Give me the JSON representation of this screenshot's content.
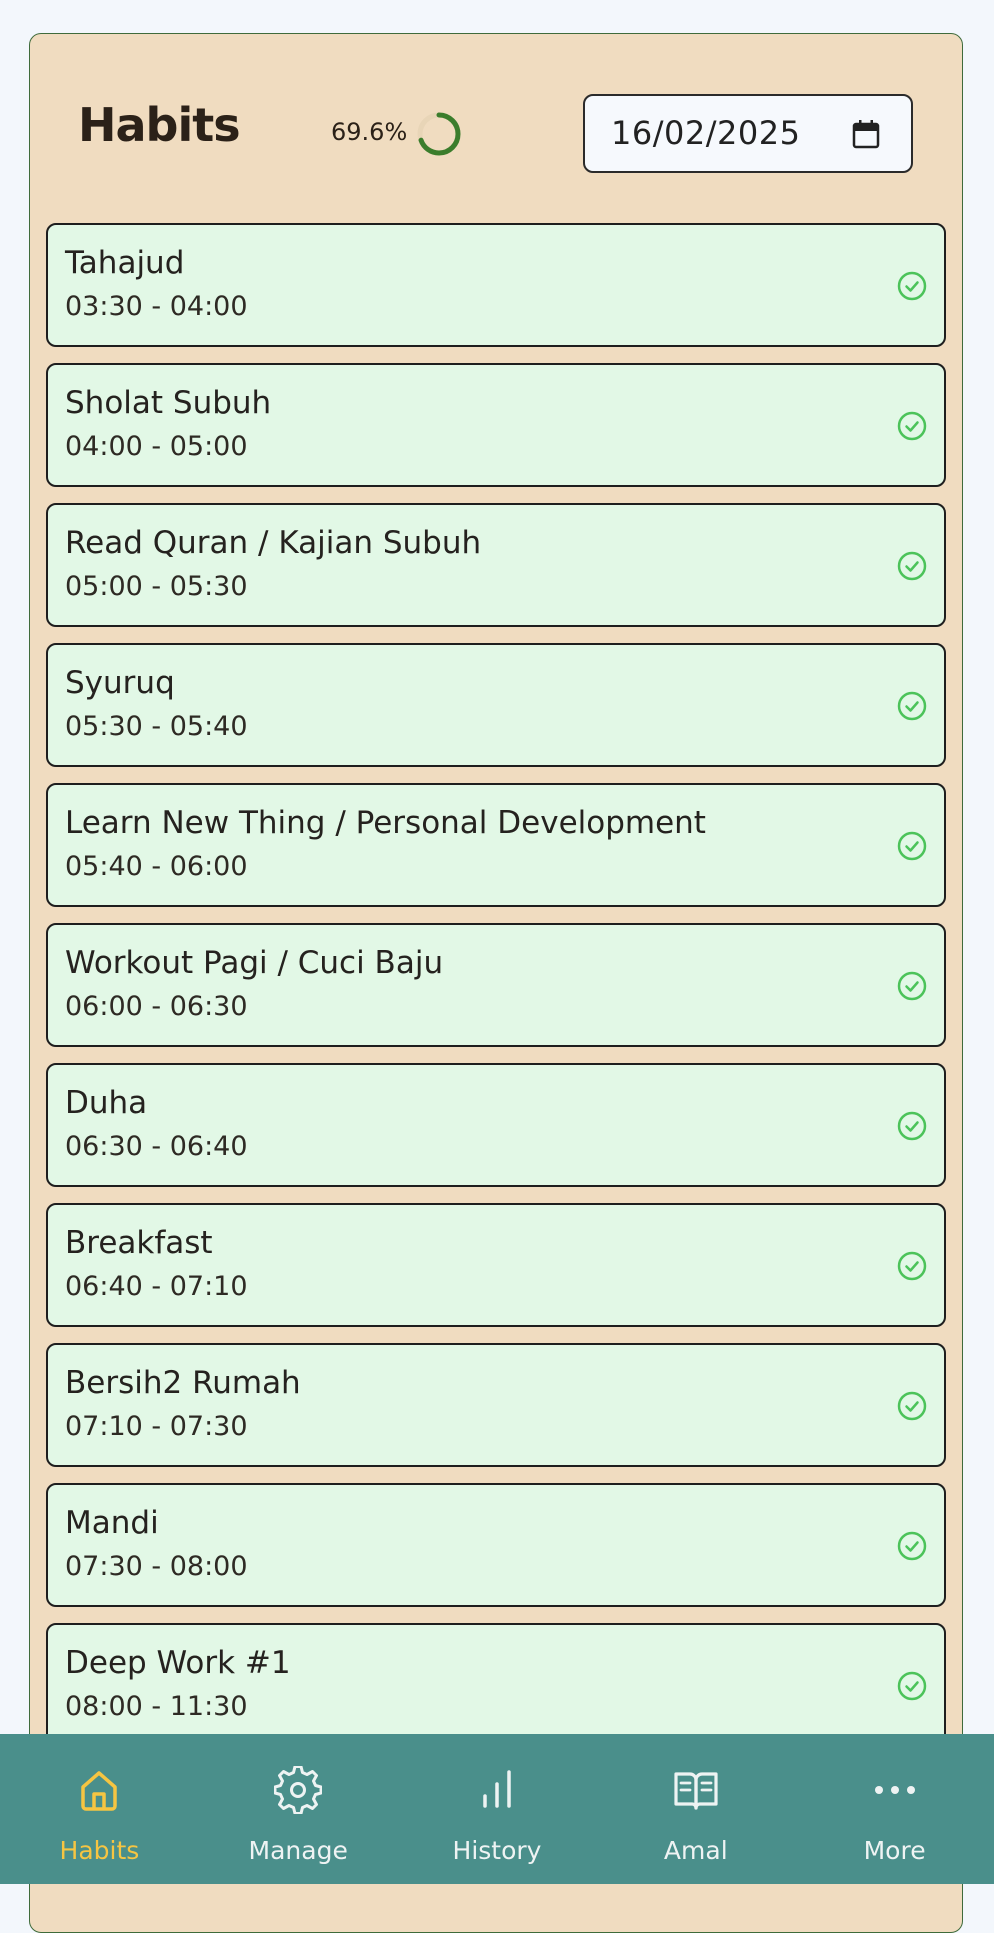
{
  "header": {
    "title": "Habits",
    "progress_text": "69.6%",
    "progress_fraction": 0.696,
    "date_value": "16/02/2025"
  },
  "colors": {
    "panel_bg": "#f0dcc0",
    "card_bg": "#e2f8e6",
    "check": "#4cc35a",
    "nav_bg": "#4a8f8b",
    "nav_active": "#f6c542",
    "progress_ring": "#3b7d2c"
  },
  "habits": [
    {
      "name": "Tahajud",
      "time": "03:30 - 04:00",
      "status_icon": "check-circle-icon"
    },
    {
      "name": "Sholat Subuh",
      "time": "04:00 - 05:00",
      "status_icon": "check-circle-icon"
    },
    {
      "name": "Read Quran / Kajian Subuh",
      "time": "05:00 - 05:30",
      "status_icon": "check-circle-icon"
    },
    {
      "name": "Syuruq",
      "time": "05:30 - 05:40",
      "status_icon": "check-circle-icon"
    },
    {
      "name": "Learn New Thing / Personal Development",
      "time": "05:40 - 06:00",
      "status_icon": "check-circle-icon"
    },
    {
      "name": "Workout Pagi / Cuci Baju",
      "time": "06:00 - 06:30",
      "status_icon": "check-circle-icon"
    },
    {
      "name": "Duha",
      "time": "06:30 - 06:40",
      "status_icon": "check-circle-icon"
    },
    {
      "name": "Breakfast",
      "time": "06:40 - 07:10",
      "status_icon": "check-circle-icon"
    },
    {
      "name": "Bersih2 Rumah",
      "time": "07:10 - 07:30",
      "status_icon": "check-circle-icon"
    },
    {
      "name": "Mandi",
      "time": "07:30 - 08:00",
      "status_icon": "check-circle-icon"
    },
    {
      "name": "Deep Work #1",
      "time": "08:00 - 11:30",
      "status_icon": "check-circle-icon"
    }
  ],
  "nav": {
    "items": [
      {
        "label": "Habits",
        "icon": "home-icon",
        "active": true
      },
      {
        "label": "Manage",
        "icon": "gear-icon",
        "active": false
      },
      {
        "label": "History",
        "icon": "bar-chart-icon",
        "active": false
      },
      {
        "label": "Amal",
        "icon": "book-icon",
        "active": false
      },
      {
        "label": "More",
        "icon": "more-dots-icon",
        "active": false
      }
    ]
  }
}
